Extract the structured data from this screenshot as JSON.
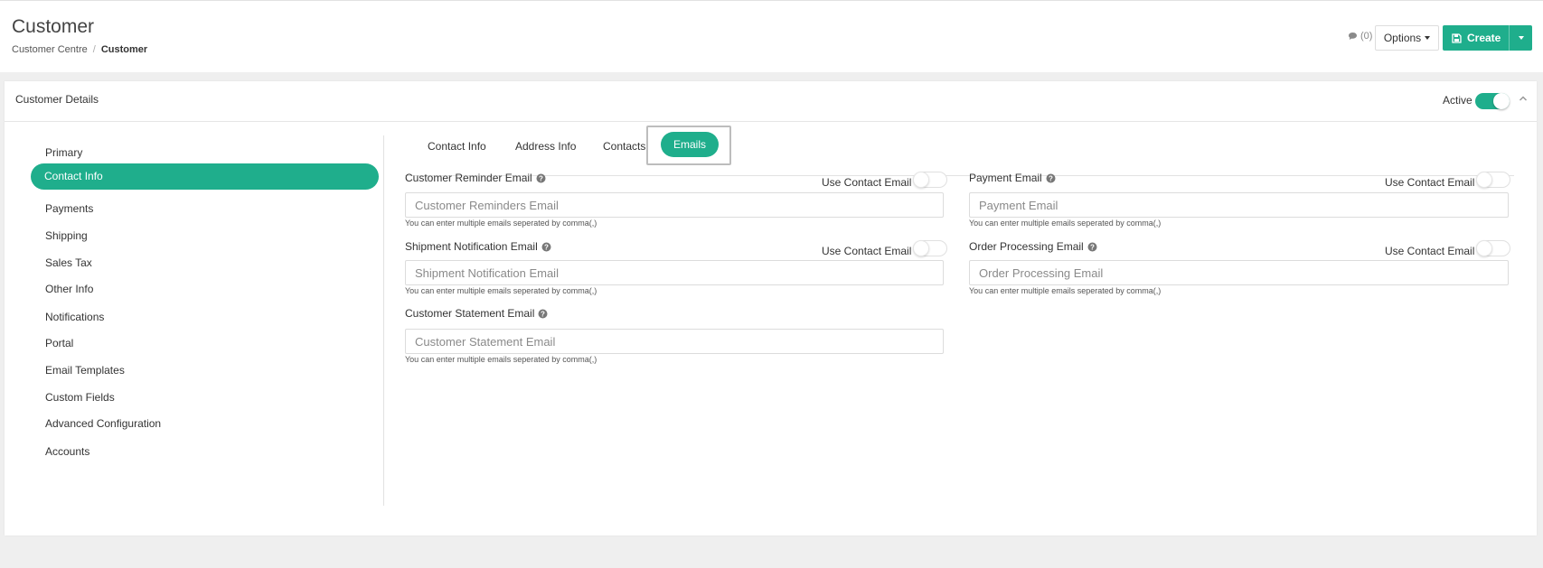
{
  "header": {
    "title": "Customer",
    "breadcrumb": [
      "Customer Centre",
      "Customer"
    ],
    "comment_count": "(0)",
    "options_label": "Options",
    "create_label": "Create"
  },
  "card": {
    "title": "Customer Details",
    "active_label": "Active",
    "active": true
  },
  "sidebar": {
    "items": [
      {
        "label": "Primary"
      },
      {
        "label": "Contact Info",
        "active": true
      },
      {
        "label": "Payments"
      },
      {
        "label": "Shipping"
      },
      {
        "label": "Sales Tax"
      },
      {
        "label": "Other Info"
      },
      {
        "label": "Notifications"
      },
      {
        "label": "Portal"
      },
      {
        "label": "Email Templates"
      },
      {
        "label": "Custom Fields"
      },
      {
        "label": "Advanced Configuration"
      },
      {
        "label": "Accounts"
      }
    ]
  },
  "tabs": [
    {
      "label": "Contact Info"
    },
    {
      "label": "Address Info"
    },
    {
      "label": "Contacts"
    },
    {
      "label": "Emails",
      "active": true
    }
  ],
  "fields": {
    "customer_reminder": {
      "label": "Customer Reminder Email",
      "placeholder": "Customer Reminders Email",
      "use_contact_label": "Use Contact Email",
      "use_contact": false,
      "hint": "You can enter multiple emails seperated by comma(,)"
    },
    "payment": {
      "label": "Payment Email",
      "placeholder": "Payment Email",
      "use_contact_label": "Use Contact Email",
      "use_contact": false,
      "hint": "You can enter multiple emails seperated by comma(,)"
    },
    "shipment_notification": {
      "label": "Shipment Notification Email",
      "placeholder": "Shipment Notification Email",
      "use_contact_label": "Use Contact Email",
      "use_contact": false,
      "hint": "You can enter multiple emails seperated by comma(,)"
    },
    "order_processing": {
      "label": "Order Processing Email",
      "placeholder": "Order Processing Email",
      "use_contact_label": "Use Contact Email",
      "use_contact": false,
      "hint": "You can enter multiple emails seperated by comma(,)"
    },
    "customer_statement": {
      "label": "Customer Statement Email",
      "placeholder": "Customer Statement Email",
      "hint": "You can enter multiple emails seperated by comma(,)"
    }
  },
  "colors": {
    "accent": "#1fae8c"
  },
  "icons": {
    "comment": "comment-icon",
    "save": "save-icon",
    "help": "help-icon",
    "collapse": "chevron-up-icon"
  }
}
